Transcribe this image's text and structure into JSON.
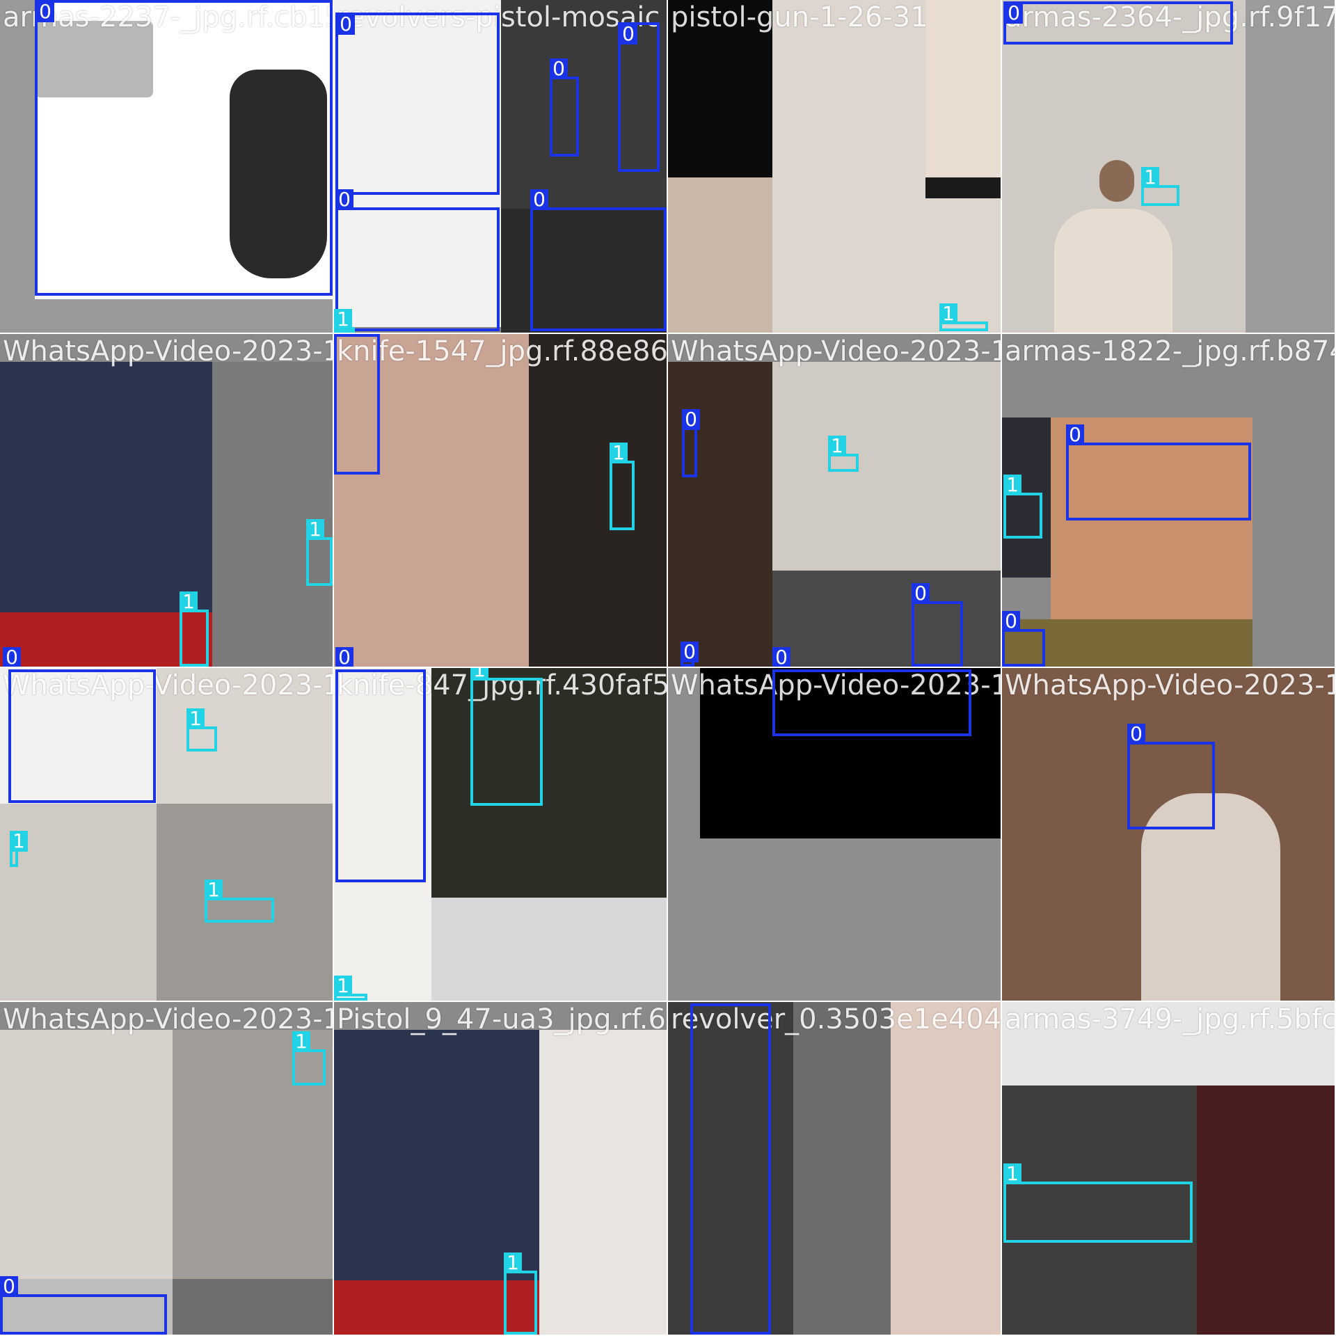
{
  "classes": {
    "0": "0",
    "1": "1"
  },
  "colors": {
    "class_0": "#1a33e6",
    "class_1": "#22d3e6",
    "tile_bg": "#8a8a8a"
  },
  "tiles": [
    {
      "name": "armas-2237-_jpg.rf.cb15821",
      "subject": "revolver close-up",
      "labels": [
        "0"
      ]
    },
    {
      "name": "revolvers-pistol-mosaic",
      "subject": "revolvers and pistol mosaic",
      "labels": [
        "0",
        "0",
        "0",
        "0",
        "0",
        "1"
      ]
    },
    {
      "name": "pistol-gun-1-26-31",
      "subject": "man holding small object",
      "labels": [
        "0",
        "1"
      ]
    },
    {
      "name": "armas-2364-_jpg.rf.9f17dbe",
      "subject": "man raising knife",
      "labels": [
        "0",
        "1"
      ]
    },
    {
      "name": "WhatsApp-Video-2023-11-22",
      "subject": "self-defense training",
      "labels": [
        "1",
        "1",
        "0"
      ]
    },
    {
      "name": "knife-1547_jpg.rf.88e869cb",
      "subject": "man with knife",
      "labels": [
        "0",
        "1",
        "0"
      ]
    },
    {
      "name": "WhatsApp-Video-2023-11-22",
      "subject": "man raising knife",
      "labels": [
        "0",
        "1",
        "0",
        "0",
        "0"
      ]
    },
    {
      "name": "armas-1822-_jpg.rf.b8744bb",
      "subject": "pistol in hand",
      "labels": [
        "1",
        "0",
        "0"
      ]
    },
    {
      "name": "WhatsApp-Video-2023-11-22",
      "subject": "knife mosaic",
      "labels": [
        "1",
        "1",
        "1"
      ]
    },
    {
      "name": "knife-847_jpg.rf.430faf5dc",
      "subject": "man with machete in forest",
      "labels": [
        "1",
        "1"
      ]
    },
    {
      "name": "WhatsApp-Video-2023-11-22",
      "subject": "dark scene",
      "labels": [
        "0"
      ]
    },
    {
      "name": "WhatsApp-Video-2023-11-22",
      "subject": "woman with pistol and child",
      "labels": [
        "0"
      ]
    },
    {
      "name": "WhatsApp-Video-2023-11-22",
      "subject": "man raising knife",
      "labels": [
        "1",
        "0"
      ]
    },
    {
      "name": "Pistol_9_47-ua3_jpg.rf.66246f",
      "subject": "self-defense training",
      "labels": [
        "1"
      ]
    },
    {
      "name": "revolver_0.3503e1e404",
      "subject": "revolver close-up",
      "labels": [
        "0"
      ]
    },
    {
      "name": "armas-3749-_jpg.rf.5bfc4aa",
      "subject": "hand holding knife",
      "labels": [
        "1"
      ]
    }
  ]
}
